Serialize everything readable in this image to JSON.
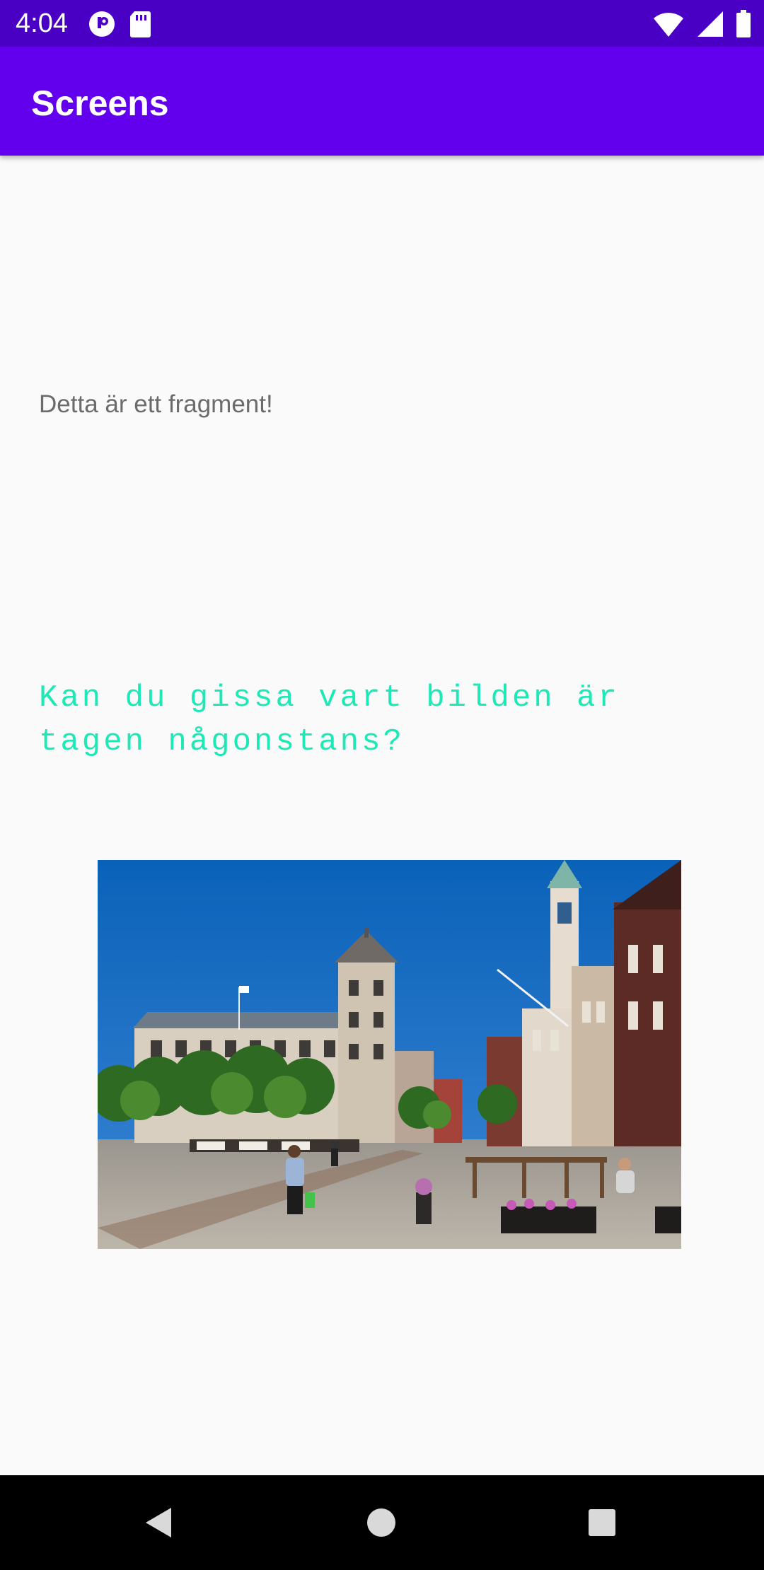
{
  "status_bar": {
    "time": "4:04",
    "left_icons": [
      "app-notification-icon",
      "sd-card-icon"
    ],
    "right_icons": [
      "wifi-icon",
      "cell-signal-icon",
      "battery-icon"
    ],
    "background": "#4a00c4"
  },
  "app_bar": {
    "title": "Screens",
    "background": "#6200ee"
  },
  "content": {
    "fragment_text": "Detta är ett fragment!",
    "question_text": "Kan du gissa vart bilden är tagen någonstans?",
    "question_color": "#1de9b6",
    "photo_icon": "town-square-photo"
  },
  "nav_bar": {
    "buttons": [
      "back-icon",
      "home-icon",
      "recents-icon"
    ]
  }
}
